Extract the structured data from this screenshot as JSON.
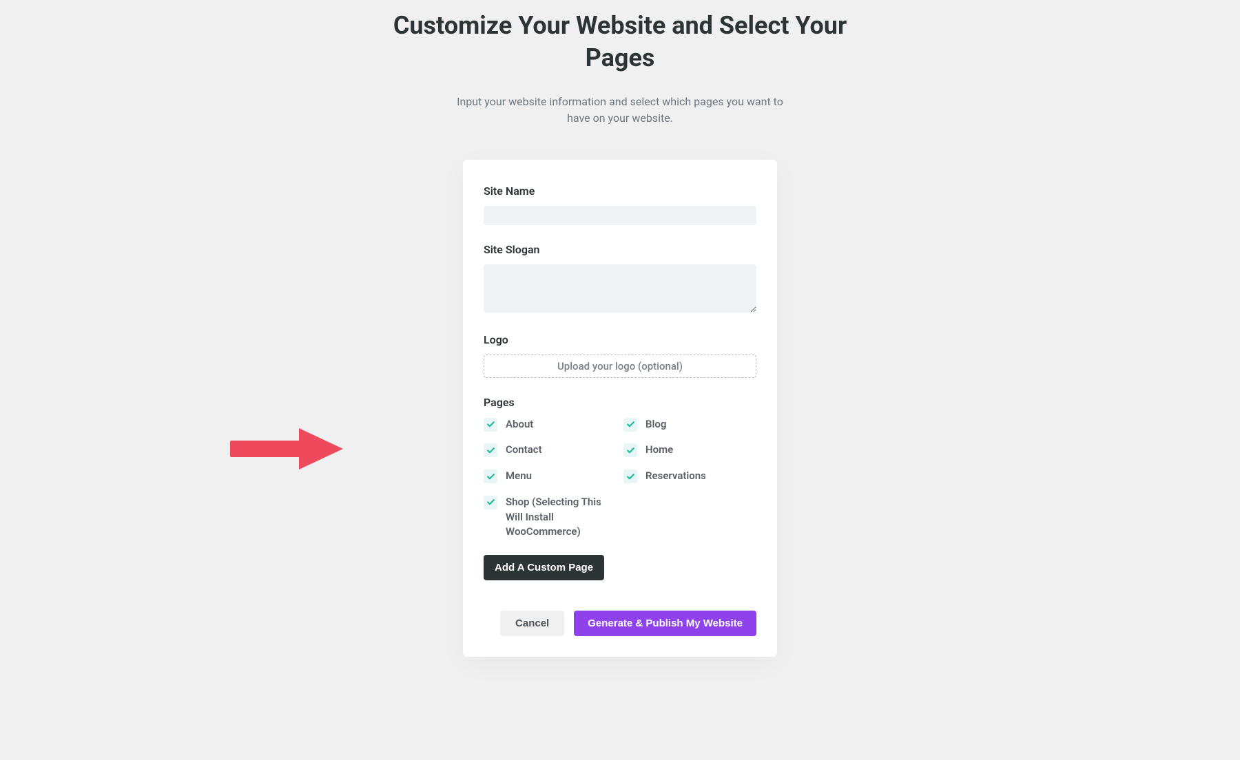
{
  "header": {
    "title": "Customize Your Website and Select Your Pages",
    "subtitle": "Input your website information and select which pages you want to have on your website."
  },
  "form": {
    "siteName": {
      "label": "Site Name",
      "value": ""
    },
    "siteSlogan": {
      "label": "Site Slogan",
      "value": ""
    },
    "logo": {
      "label": "Logo",
      "uploadText": "Upload your logo (optional)"
    },
    "pages": {
      "label": "Pages",
      "items": [
        {
          "label": "About",
          "checked": true
        },
        {
          "label": "Blog",
          "checked": true
        },
        {
          "label": "Contact",
          "checked": true
        },
        {
          "label": "Home",
          "checked": true
        },
        {
          "label": "Menu",
          "checked": true
        },
        {
          "label": "Reservations",
          "checked": true
        },
        {
          "label": "Shop (Selecting This Will Install WooCommerce)",
          "checked": true
        }
      ],
      "addCustomLabel": "Add A Custom Page"
    }
  },
  "actions": {
    "cancel": "Cancel",
    "submit": "Generate & Publish My Website"
  },
  "annotation": {
    "arrowColor": "#ef4a5b"
  }
}
